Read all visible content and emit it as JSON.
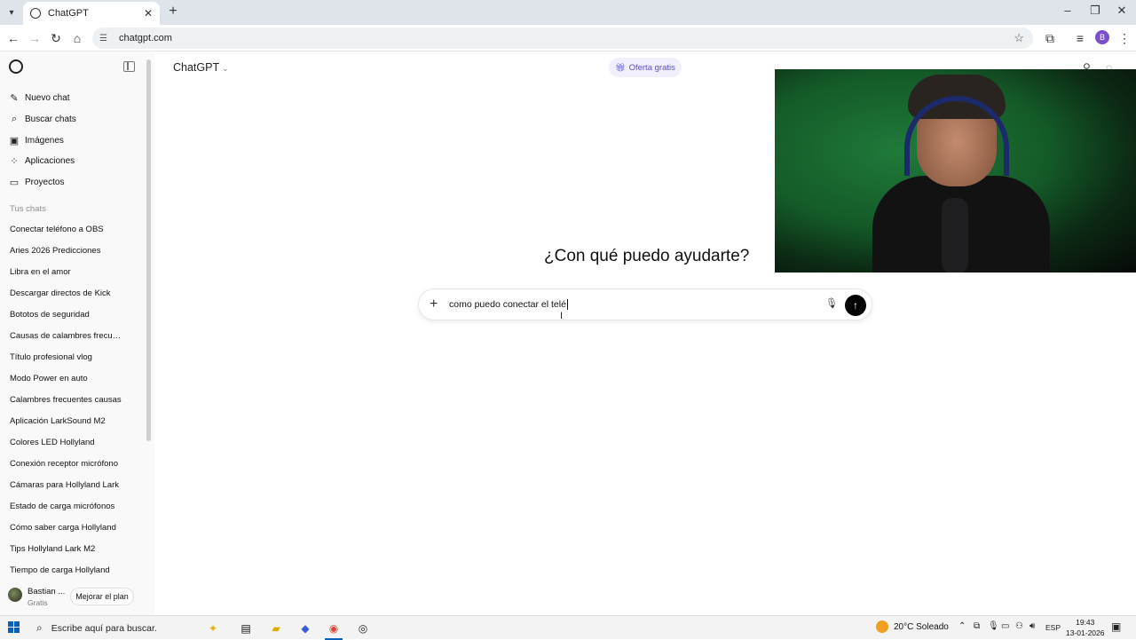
{
  "browser": {
    "tab_title": "ChatGPT",
    "url": "chatgpt.com",
    "profile_initial": "B"
  },
  "sidebar": {
    "actions": [
      {
        "label": "Nuevo chat",
        "icon": "edit-icon"
      },
      {
        "label": "Buscar chats",
        "icon": "search-icon"
      },
      {
        "label": "Imágenes",
        "icon": "image-icon"
      },
      {
        "label": "Aplicaciones",
        "icon": "apps-icon"
      },
      {
        "label": "Proyectos",
        "icon": "folder-icon"
      }
    ],
    "section_title": "Tus chats",
    "chats": [
      "Conectar teléfono a OBS",
      "Aries 2026 Predicciones",
      "Libra en el amor",
      "Descargar directos de Kick",
      "Bototos de seguridad",
      "Causas de calambres frecuentes",
      "Título profesional vlog",
      "Modo Power en auto",
      "Calambres frecuentes causas",
      "Aplicación LarkSound M2",
      "Colores LED Hollyland",
      "Conexión receptor micrófono",
      "Cámaras para Hollyland Lark",
      "Estado de carga micrófonos",
      "Cómo saber carga Hollyland",
      "Tips Hollyland Lark M2",
      "Tiempo de carga Hollyland"
    ],
    "user_name": "Bastian ...",
    "user_plan": "Gratis",
    "upgrade_label": "Mejorar el plan"
  },
  "main": {
    "model_label": "ChatGPT",
    "offer_label": "Oferta gratis",
    "headline": "¿Con qué puedo ayudarte?",
    "composer_text": "como puedo conectar el telé"
  },
  "taskbar": {
    "search_placeholder": "Escribe aquí para buscar.",
    "weather": "20°C  Soleado",
    "lang": "ESP",
    "time": "19:43",
    "date": "13-01-2026"
  }
}
